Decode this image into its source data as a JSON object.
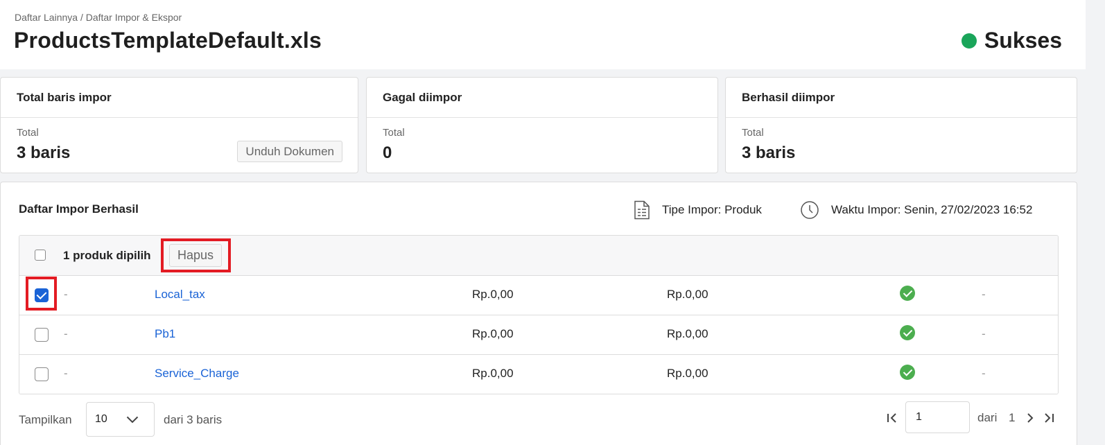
{
  "header": {
    "breadcrumb": "Daftar Lainnya / Daftar Impor & Ekspor",
    "title": "ProductsTemplateDefault.xls",
    "status": "Sukses",
    "status_color": "#1aa55a"
  },
  "cards": [
    {
      "title": "Total baris impor",
      "sub": "Total",
      "value": "3 baris",
      "button": "Unduh Dokumen"
    },
    {
      "title": "Gagal diimpor",
      "sub": "Total",
      "value": "0"
    },
    {
      "title": "Berhasil diimpor",
      "sub": "Total",
      "value": "3 baris"
    }
  ],
  "panel": {
    "title": "Daftar Impor Berhasil",
    "import_type": "Tipe Impor: Produk",
    "import_time": "Waktu Impor: Senin, 27/02/2023 16:52"
  },
  "table": {
    "selected_text": "1 produk dipilih",
    "delete_label": "Hapus",
    "rows": [
      {
        "checked": true,
        "code": "-",
        "name": "Local_tax",
        "price1": "Rp.0,00",
        "price2": "Rp.0,00",
        "status": "success",
        "note": "-"
      },
      {
        "checked": false,
        "code": "-",
        "name": "Pb1",
        "price1": "Rp.0,00",
        "price2": "Rp.0,00",
        "status": "success",
        "note": "-"
      },
      {
        "checked": false,
        "code": "-",
        "name": "Service_Charge",
        "price1": "Rp.0,00",
        "price2": "Rp.0,00",
        "status": "success",
        "note": "-"
      }
    ]
  },
  "footer": {
    "show_label": "Tampilkan",
    "page_size": "10",
    "of_rows": "dari 3 baris",
    "current_page": "1",
    "of_label": "dari",
    "total_pages": "1"
  },
  "colors": {
    "accent": "#1a63d6",
    "success": "#4cae4f",
    "highlight": "#e31b23"
  }
}
